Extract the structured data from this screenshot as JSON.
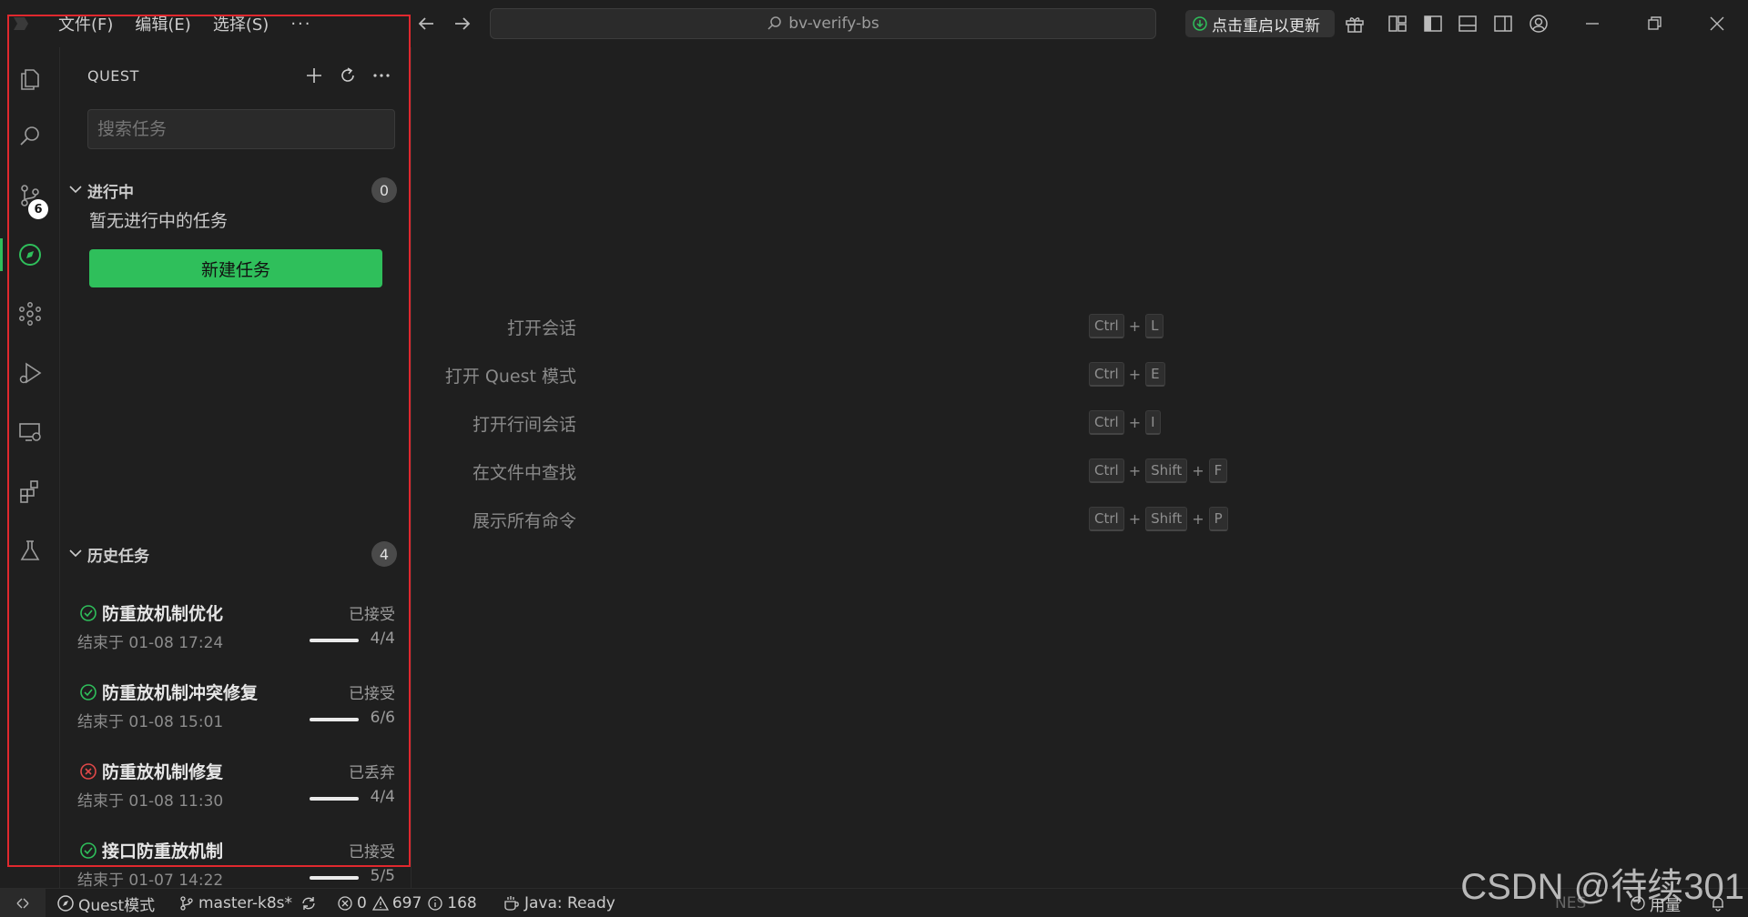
{
  "titlebar": {
    "menu": [
      "文件(F)",
      "编辑(E)",
      "选择(S)"
    ],
    "more": "···",
    "search_text": "bv-verify-bs",
    "update_label": "点击重启以更新"
  },
  "sidebar": {
    "title": "QUEST",
    "search_placeholder": "搜索任务",
    "in_progress": {
      "label": "进行中",
      "count": "0",
      "empty_text": "暂无进行中的任务",
      "new_task_label": "新建任务"
    },
    "history": {
      "label": "历史任务",
      "count": "4",
      "tasks": [
        {
          "name": "防重放机制优化",
          "state": "已接受",
          "time": "结束于 01-08 17:24",
          "progress": "4/4",
          "status": "accepted",
          "fraction": 1.0
        },
        {
          "name": "防重放机制冲突修复",
          "state": "已接受",
          "time": "结束于 01-08 15:01",
          "progress": "6/6",
          "status": "accepted",
          "fraction": 1.0
        },
        {
          "name": "防重放机制修复",
          "state": "已丢弃",
          "time": "结束于 01-08 11:30",
          "progress": "4/4",
          "status": "discarded",
          "fraction": 1.0
        },
        {
          "name": "接口防重放机制",
          "state": "已接受",
          "time": "结束于 01-07 14:22",
          "progress": "5/5",
          "status": "accepted",
          "fraction": 1.0
        }
      ]
    }
  },
  "activity_badge": "6",
  "welcome": {
    "shortcuts": [
      {
        "label": "打开会话",
        "keys": [
          "Ctrl",
          "L"
        ]
      },
      {
        "label": "打开 Quest 模式",
        "keys": [
          "Ctrl",
          "E"
        ]
      },
      {
        "label": "打开行间会话",
        "keys": [
          "Ctrl",
          "I"
        ]
      },
      {
        "label": "在文件中查找",
        "keys": [
          "Ctrl",
          "Shift",
          "F"
        ]
      },
      {
        "label": "展示所有命令",
        "keys": [
          "Ctrl",
          "Shift",
          "P"
        ]
      }
    ]
  },
  "statusbar": {
    "quest_mode": "Quest模式",
    "branch": "master-k8s*",
    "errors": "0",
    "warnings": "697",
    "infos": "168",
    "java": "Java: Ready",
    "nes": "NES",
    "usage": "用量"
  },
  "watermark": "CSDN @待续301",
  "colors": {
    "accent_green": "#2fbf5b",
    "discard_red": "#e04848",
    "frame_red": "#e0282e"
  },
  "icons": {
    "activity": [
      "files-icon",
      "search-icon",
      "source-control-icon",
      "quest-compass-icon",
      "agents-icon",
      "run-debug-icon",
      "remote-explorer-icon",
      "extensions-icon",
      "testing-flask-icon"
    ]
  }
}
